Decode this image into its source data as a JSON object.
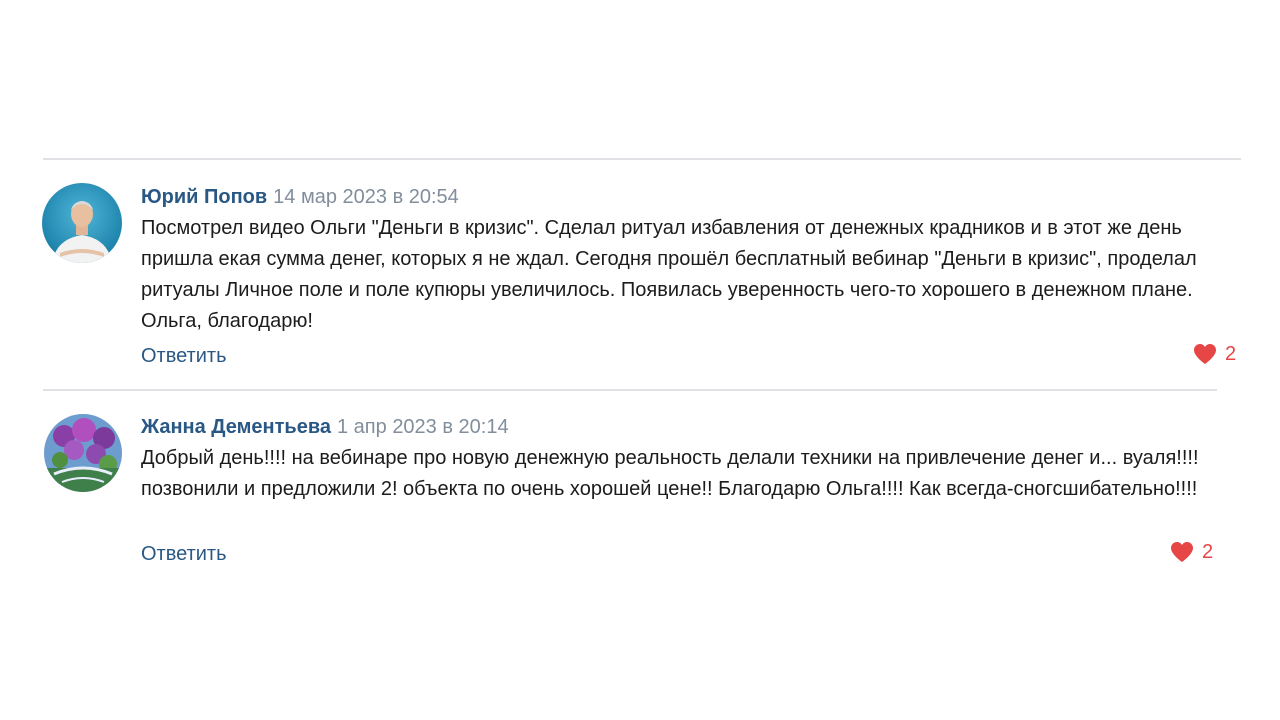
{
  "colors": {
    "author": "#2a5885",
    "date": "#828e9c",
    "text": "#1c1c1c",
    "like": "#e64646",
    "divider": "#dfe1e5"
  },
  "comments": [
    {
      "author": "Юрий Попов",
      "date": "14 мар 2023 в 20:54",
      "text": "Посмотрел видео Ольги \"Деньги в кризис\". Сделал ритуал избавления от денежных крадников и в этот же день пришла екая сумма денег, которых я не ждал. Сегодня прошёл бесплатный вебинар \"Деньги в кризис\", проделал ритуалы Личное поле и поле купюры увеличилось. Появилась уверенность чего-то хорошего в денежном плане. Ольга, благодарю!",
      "reply_label": "Ответить",
      "likes": "2",
      "like_icon": "heart-icon"
    },
    {
      "author": "Жанна Дементьева",
      "date": "1 апр 2023 в 20:14",
      "text": "Добрый день!!!! на вебинаре про новую денежную реальность делали техники на привлечение денег и... вуаля!!!! позвонили и предложили 2! объекта по очень хорошей цене!! Благодарю Ольга!!!! Как всегда-сногсшибательно!!!!",
      "reply_label": "Ответить",
      "likes": "2",
      "like_icon": "heart-icon"
    }
  ]
}
